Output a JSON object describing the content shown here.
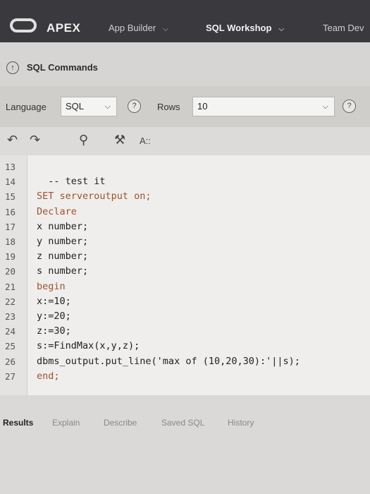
{
  "topbar": {
    "product": "APEX",
    "nav": [
      {
        "label": "App Builder",
        "has_menu": true
      },
      {
        "label": "SQL Workshop",
        "has_menu": true,
        "active": true
      },
      {
        "label": "Team Dev",
        "has_menu": false
      }
    ]
  },
  "page": {
    "title": "SQL Commands",
    "up_icon": "↑"
  },
  "options": {
    "language_label": "Language",
    "language_value": "SQL",
    "rows_label": "Rows",
    "rows_value": "10",
    "help_glyph": "?"
  },
  "editor_tools": {
    "undo": "↶",
    "redo": "↷",
    "search": "⚲",
    "hammer": "⚒",
    "autocomplete": "A::"
  },
  "code": {
    "lines": [
      {
        "n": "13",
        "text": ""
      },
      {
        "n": "14",
        "text": "  -- test it"
      },
      {
        "n": "15",
        "text": "SET serveroutput on;"
      },
      {
        "n": "16",
        "text": "Declare"
      },
      {
        "n": "17",
        "text": "x number;"
      },
      {
        "n": "18",
        "text": "y number;"
      },
      {
        "n": "19",
        "text": "z number;"
      },
      {
        "n": "20",
        "text": "s number;"
      },
      {
        "n": "21",
        "text": "begin"
      },
      {
        "n": "22",
        "text": "x:=10;"
      },
      {
        "n": "23",
        "text": "y:=20;"
      },
      {
        "n": "24",
        "text": "z:=30;"
      },
      {
        "n": "25",
        "text": "s:=FindMax(x,y,z);"
      },
      {
        "n": "26",
        "text": "dbms_output.put_line('max of (10,20,30):'||s);"
      },
      {
        "n": "27",
        "text": "end;"
      }
    ]
  },
  "results": {
    "tabs": [
      "Results",
      "Explain",
      "Describe",
      "Saved SQL",
      "History"
    ],
    "active": "Results"
  },
  "colors": {
    "topbar": "#3a3a3e",
    "keyword": "#a0522d"
  }
}
